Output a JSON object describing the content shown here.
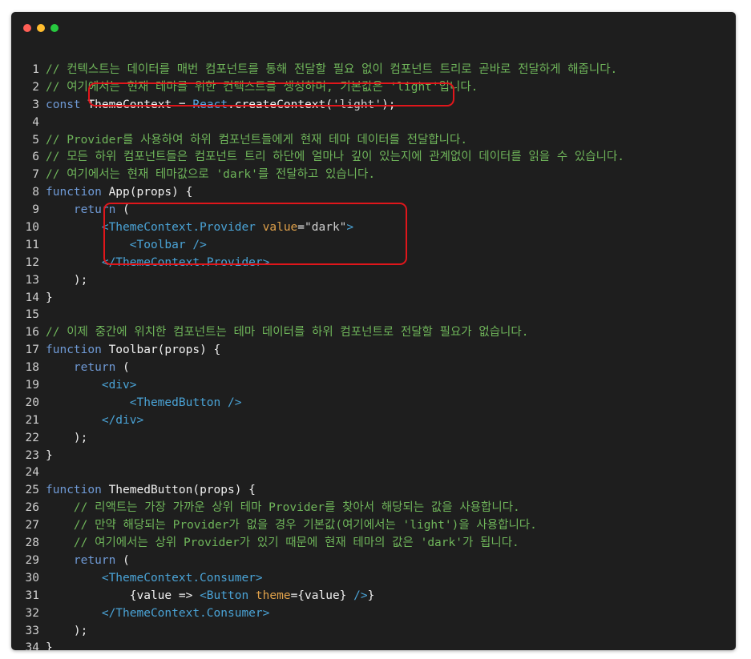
{
  "window": {
    "controls": {
      "close_color": "#ff5f56",
      "minimize_color": "#ffbd2e",
      "zoom_color": "#27c93f"
    }
  },
  "editor": {
    "highlight_color": "#e0161b",
    "lines": [
      {
        "n": "1",
        "tokens": [
          {
            "t": "c",
            "v": "// 컨텍스트는 데이터를 매번 컴포넌트를 통해 전달할 필요 없이 컴포넌트 트리로 곧바로 전달하게 해줍니다."
          }
        ]
      },
      {
        "n": "2",
        "tokens": [
          {
            "t": "c",
            "v": "// 여기에서는 현재 테마를 위한 컨텍스트를 생성하며, 기본값은 'light'입니다."
          }
        ]
      },
      {
        "n": "3",
        "tokens": [
          {
            "t": "kw",
            "v": "const "
          },
          {
            "t": "id",
            "v": "ThemeContext"
          },
          {
            "t": "id",
            "v": " = "
          },
          {
            "t": "cls",
            "v": "React"
          },
          {
            "t": "id",
            "v": ".createContext("
          },
          {
            "t": "str",
            "v": "'light'"
          },
          {
            "t": "id",
            "v": ");"
          }
        ]
      },
      {
        "n": "4",
        "tokens": []
      },
      {
        "n": "5",
        "tokens": [
          {
            "t": "c",
            "v": "// Provider를 사용하여 하위 컴포넌트들에게 현재 테마 데이터를 전달합니다."
          }
        ]
      },
      {
        "n": "6",
        "tokens": [
          {
            "t": "c",
            "v": "// 모든 하위 컴포넌트들은 컴포넌트 트리 하단에 얼마나 깊이 있는지에 관계없이 데이터를 읽을 수 있습니다."
          }
        ]
      },
      {
        "n": "7",
        "tokens": [
          {
            "t": "c",
            "v": "// 여기에서는 현재 테마값으로 'dark'를 전달하고 있습니다."
          }
        ]
      },
      {
        "n": "8",
        "tokens": [
          {
            "t": "kw",
            "v": "function "
          },
          {
            "t": "id",
            "v": "App(props) {"
          }
        ]
      },
      {
        "n": "9",
        "tokens": [
          {
            "t": "id",
            "v": "    "
          },
          {
            "t": "kw",
            "v": "return"
          },
          {
            "t": "id",
            "v": " ("
          }
        ]
      },
      {
        "n": "10",
        "tokens": [
          {
            "t": "id",
            "v": "        "
          },
          {
            "t": "tag",
            "v": "<ThemeContext.Provider "
          },
          {
            "t": "at",
            "v": "value"
          },
          {
            "t": "id",
            "v": "="
          },
          {
            "t": "str",
            "v": "\"dark\""
          },
          {
            "t": "tag",
            "v": ">"
          }
        ]
      },
      {
        "n": "11",
        "tokens": [
          {
            "t": "id",
            "v": "            "
          },
          {
            "t": "tag",
            "v": "<Toolbar />"
          }
        ]
      },
      {
        "n": "12",
        "tokens": [
          {
            "t": "id",
            "v": "        "
          },
          {
            "t": "tag",
            "v": "</ThemeContext.Provider>"
          }
        ]
      },
      {
        "n": "13",
        "tokens": [
          {
            "t": "id",
            "v": "    );"
          }
        ]
      },
      {
        "n": "14",
        "tokens": [
          {
            "t": "id",
            "v": "}"
          }
        ]
      },
      {
        "n": "15",
        "tokens": []
      },
      {
        "n": "16",
        "tokens": [
          {
            "t": "c",
            "v": "// 이제 중간에 위치한 컴포넌트는 테마 데이터를 하위 컴포넌트로 전달할 필요가 없습니다."
          }
        ]
      },
      {
        "n": "17",
        "tokens": [
          {
            "t": "kw",
            "v": "function "
          },
          {
            "t": "id",
            "v": "Toolbar(props) {"
          }
        ]
      },
      {
        "n": "18",
        "tokens": [
          {
            "t": "id",
            "v": "    "
          },
          {
            "t": "kw",
            "v": "return"
          },
          {
            "t": "id",
            "v": " ("
          }
        ]
      },
      {
        "n": "19",
        "tokens": [
          {
            "t": "id",
            "v": "        "
          },
          {
            "t": "tag",
            "v": "<div>"
          }
        ]
      },
      {
        "n": "20",
        "tokens": [
          {
            "t": "id",
            "v": "            "
          },
          {
            "t": "tag",
            "v": "<ThemedButton />"
          }
        ]
      },
      {
        "n": "21",
        "tokens": [
          {
            "t": "id",
            "v": "        "
          },
          {
            "t": "tag",
            "v": "</div>"
          }
        ]
      },
      {
        "n": "22",
        "tokens": [
          {
            "t": "id",
            "v": "    );"
          }
        ]
      },
      {
        "n": "23",
        "tokens": [
          {
            "t": "id",
            "v": "}"
          }
        ]
      },
      {
        "n": "24",
        "tokens": []
      },
      {
        "n": "25",
        "tokens": [
          {
            "t": "kw",
            "v": "function "
          },
          {
            "t": "id",
            "v": "ThemedButton(props) {"
          }
        ]
      },
      {
        "n": "26",
        "tokens": [
          {
            "t": "id",
            "v": "    "
          },
          {
            "t": "c",
            "v": "// 리액트는 가장 가까운 상위 테마 Provider를 찾아서 해당되는 값을 사용합니다."
          }
        ]
      },
      {
        "n": "27",
        "tokens": [
          {
            "t": "id",
            "v": "    "
          },
          {
            "t": "c",
            "v": "// 만약 해당되는 Provider가 없을 경우 기본값(여기에서는 'light')을 사용합니다."
          }
        ]
      },
      {
        "n": "28",
        "tokens": [
          {
            "t": "id",
            "v": "    "
          },
          {
            "t": "c",
            "v": "// 여기에서는 상위 Provider가 있기 때문에 현재 테마의 값은 'dark'가 됩니다."
          }
        ]
      },
      {
        "n": "29",
        "tokens": [
          {
            "t": "id",
            "v": "    "
          },
          {
            "t": "kw",
            "v": "return"
          },
          {
            "t": "id",
            "v": " ("
          }
        ]
      },
      {
        "n": "30",
        "tokens": [
          {
            "t": "id",
            "v": "        "
          },
          {
            "t": "tag",
            "v": "<ThemeContext.Consumer>"
          }
        ]
      },
      {
        "n": "31",
        "tokens": [
          {
            "t": "id",
            "v": "            {value => "
          },
          {
            "t": "tag",
            "v": "<Button "
          },
          {
            "t": "at",
            "v": "theme"
          },
          {
            "t": "id",
            "v": "={value} "
          },
          {
            "t": "tag",
            "v": "/>"
          },
          {
            "t": "id",
            "v": "}"
          }
        ]
      },
      {
        "n": "32",
        "tokens": [
          {
            "t": "id",
            "v": "        "
          },
          {
            "t": "tag",
            "v": "</ThemeContext.Consumer>"
          }
        ]
      },
      {
        "n": "33",
        "tokens": [
          {
            "t": "id",
            "v": "    );"
          }
        ]
      },
      {
        "n": "34",
        "tokens": [
          {
            "t": "id",
            "v": "}"
          }
        ]
      }
    ]
  }
}
